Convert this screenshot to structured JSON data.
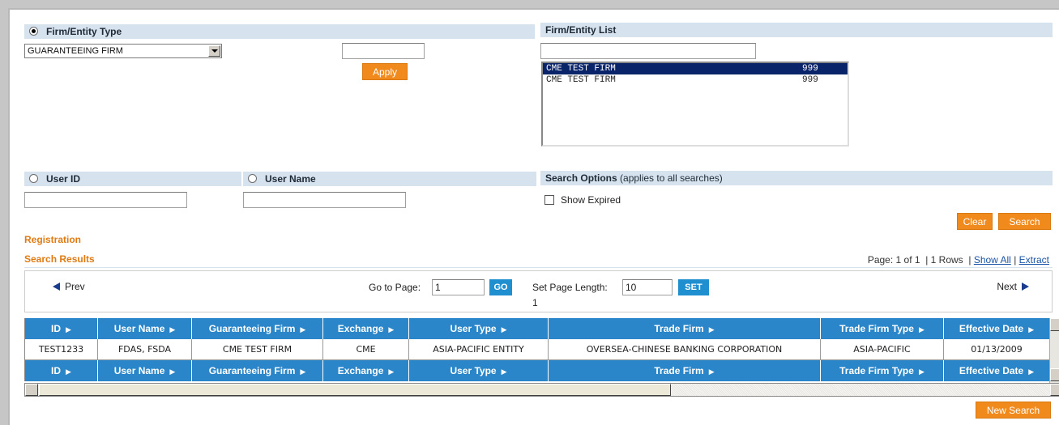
{
  "firm_entity_type": {
    "label": "Firm/Entity Type",
    "selected": "GUARANTEEING FIRM",
    "apply_label": "Apply",
    "apply_input_value": ""
  },
  "firm_entity_list": {
    "label": "Firm/Entity List",
    "filter_value": "",
    "items": [
      {
        "name": "CME TEST FIRM",
        "code": "999",
        "selected": true
      },
      {
        "name": "CME TEST FIRM",
        "code": "999",
        "selected": false
      }
    ]
  },
  "user_id": {
    "label": "User ID",
    "value": ""
  },
  "user_name": {
    "label": "User Name",
    "value": ""
  },
  "search_options": {
    "label": "Search Options",
    "note": "(applies to all searches)",
    "show_expired_label": "Show Expired",
    "show_expired_checked": false
  },
  "actions": {
    "clear_label": "Clear",
    "search_label": "Search",
    "new_search_label": "New Search"
  },
  "registration_label": "Registration",
  "results": {
    "title": "Search Results",
    "page_info": "Page: 1 of 1",
    "rows_info": "| 1 Rows",
    "sep1": "|",
    "show_all": "Show All",
    "sep2": "|",
    "extract": "Extract"
  },
  "pager": {
    "prev_label": "Prev",
    "next_label": "Next",
    "goto_label": "Go to Page:",
    "goto_value": "1",
    "go_label": "GO",
    "page_length_label": "Set Page Length:",
    "page_length_value": "10",
    "set_label": "SET",
    "current_page": "1"
  },
  "table": {
    "columns": [
      "ID",
      "User Name",
      "Guaranteeing Firm",
      "Exchange",
      "User Type",
      "Trade Firm",
      "Trade Firm Type",
      "Effective Date"
    ],
    "rows": [
      [
        "TEST1233",
        "FDAS, FSDA",
        "CME TEST FIRM",
        "CME",
        "ASIA-PACIFIC ENTITY",
        "OVERSEA-CHINESE BANKING CORPORATION",
        "ASIA-PACIFIC",
        "01/13/2009"
      ]
    ]
  },
  "colors": {
    "header_band": "#d6e3ef",
    "accent_orange": "#f08a1c",
    "grid_header": "#2a86c8",
    "link": "#1a54a8"
  }
}
